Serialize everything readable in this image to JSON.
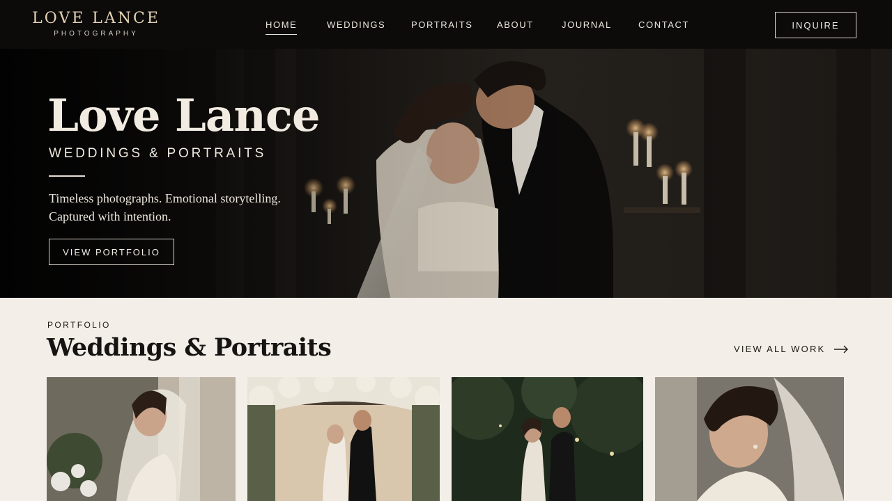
{
  "brand": {
    "name": "LOVE LANCE",
    "tagline": "PHOTOGRAPHY"
  },
  "nav": {
    "items": [
      {
        "label": "HOME",
        "active": true
      },
      {
        "label": "WEDDINGS",
        "active": false
      },
      {
        "label": "PORTRAITS",
        "active": false
      },
      {
        "label": "ABOUT",
        "active": false
      },
      {
        "label": "JOURNAL",
        "active": false
      },
      {
        "label": "CONTACT",
        "active": false
      }
    ],
    "cta": "INQUIRE"
  },
  "hero": {
    "title": "Love Lance",
    "subtitle": "WEDDINGS & PORTRAITS",
    "tagline_line1": "Timeless photographs. Emotional storytelling.",
    "tagline_line2": "Captured with intention.",
    "button": "VIEW PORTFOLIO"
  },
  "portfolio": {
    "eyebrow": "PORTFOLIO",
    "title": "Weddings & Portraits",
    "view_all": "VIEW ALL WORK"
  },
  "colors": {
    "nav_bg": "#0c0b0a",
    "logo_gold": "#e3d2b4",
    "section_bg": "#f3eee8"
  }
}
